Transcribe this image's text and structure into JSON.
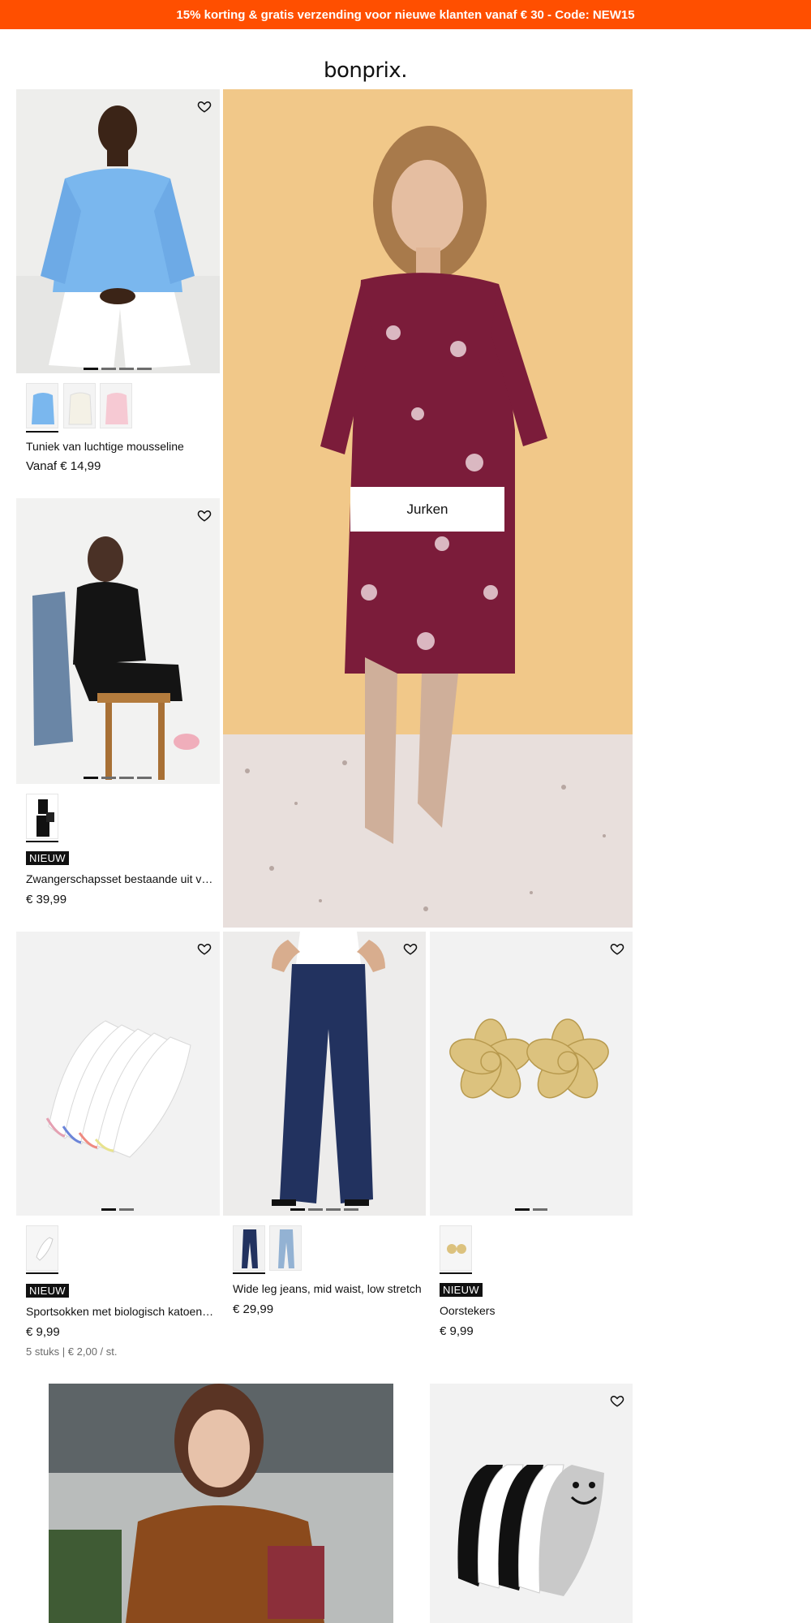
{
  "promo_banner": {
    "text": "15% korting & gratis verzending voor nieuwe klanten vanaf € 30 - Code: NEW15"
  },
  "logo": {
    "text": "bonprix."
  },
  "hero": {
    "category_button": "Jurken"
  },
  "products": [
    {
      "name": "Tuniek van luchtige mousseline",
      "price": "Vanaf € 14,99",
      "badge": "",
      "extra": ""
    },
    {
      "name": "Zwangerschapsset bestaande uit v…",
      "price": "€ 39,99",
      "badge": "NIEUW",
      "extra": ""
    },
    {
      "name": "Sportsokken met biologisch katoen…",
      "price": "€ 9,99",
      "badge": "NIEUW",
      "extra": "5 stuks | € 2,00 / st."
    },
    {
      "name": "Wide leg jeans, mid waist, low stretch",
      "price": "€ 29,99",
      "badge": "",
      "extra": ""
    },
    {
      "name": "Oorstekers",
      "price": "€ 9,99",
      "badge": "NIEUW",
      "extra": ""
    }
  ],
  "icons": {
    "wishlist": "heart-outline-icon"
  },
  "colors": {
    "promo_bg": "#ff4f00",
    "badge_bg": "#111111",
    "image_bg": "#f2f2f2"
  }
}
